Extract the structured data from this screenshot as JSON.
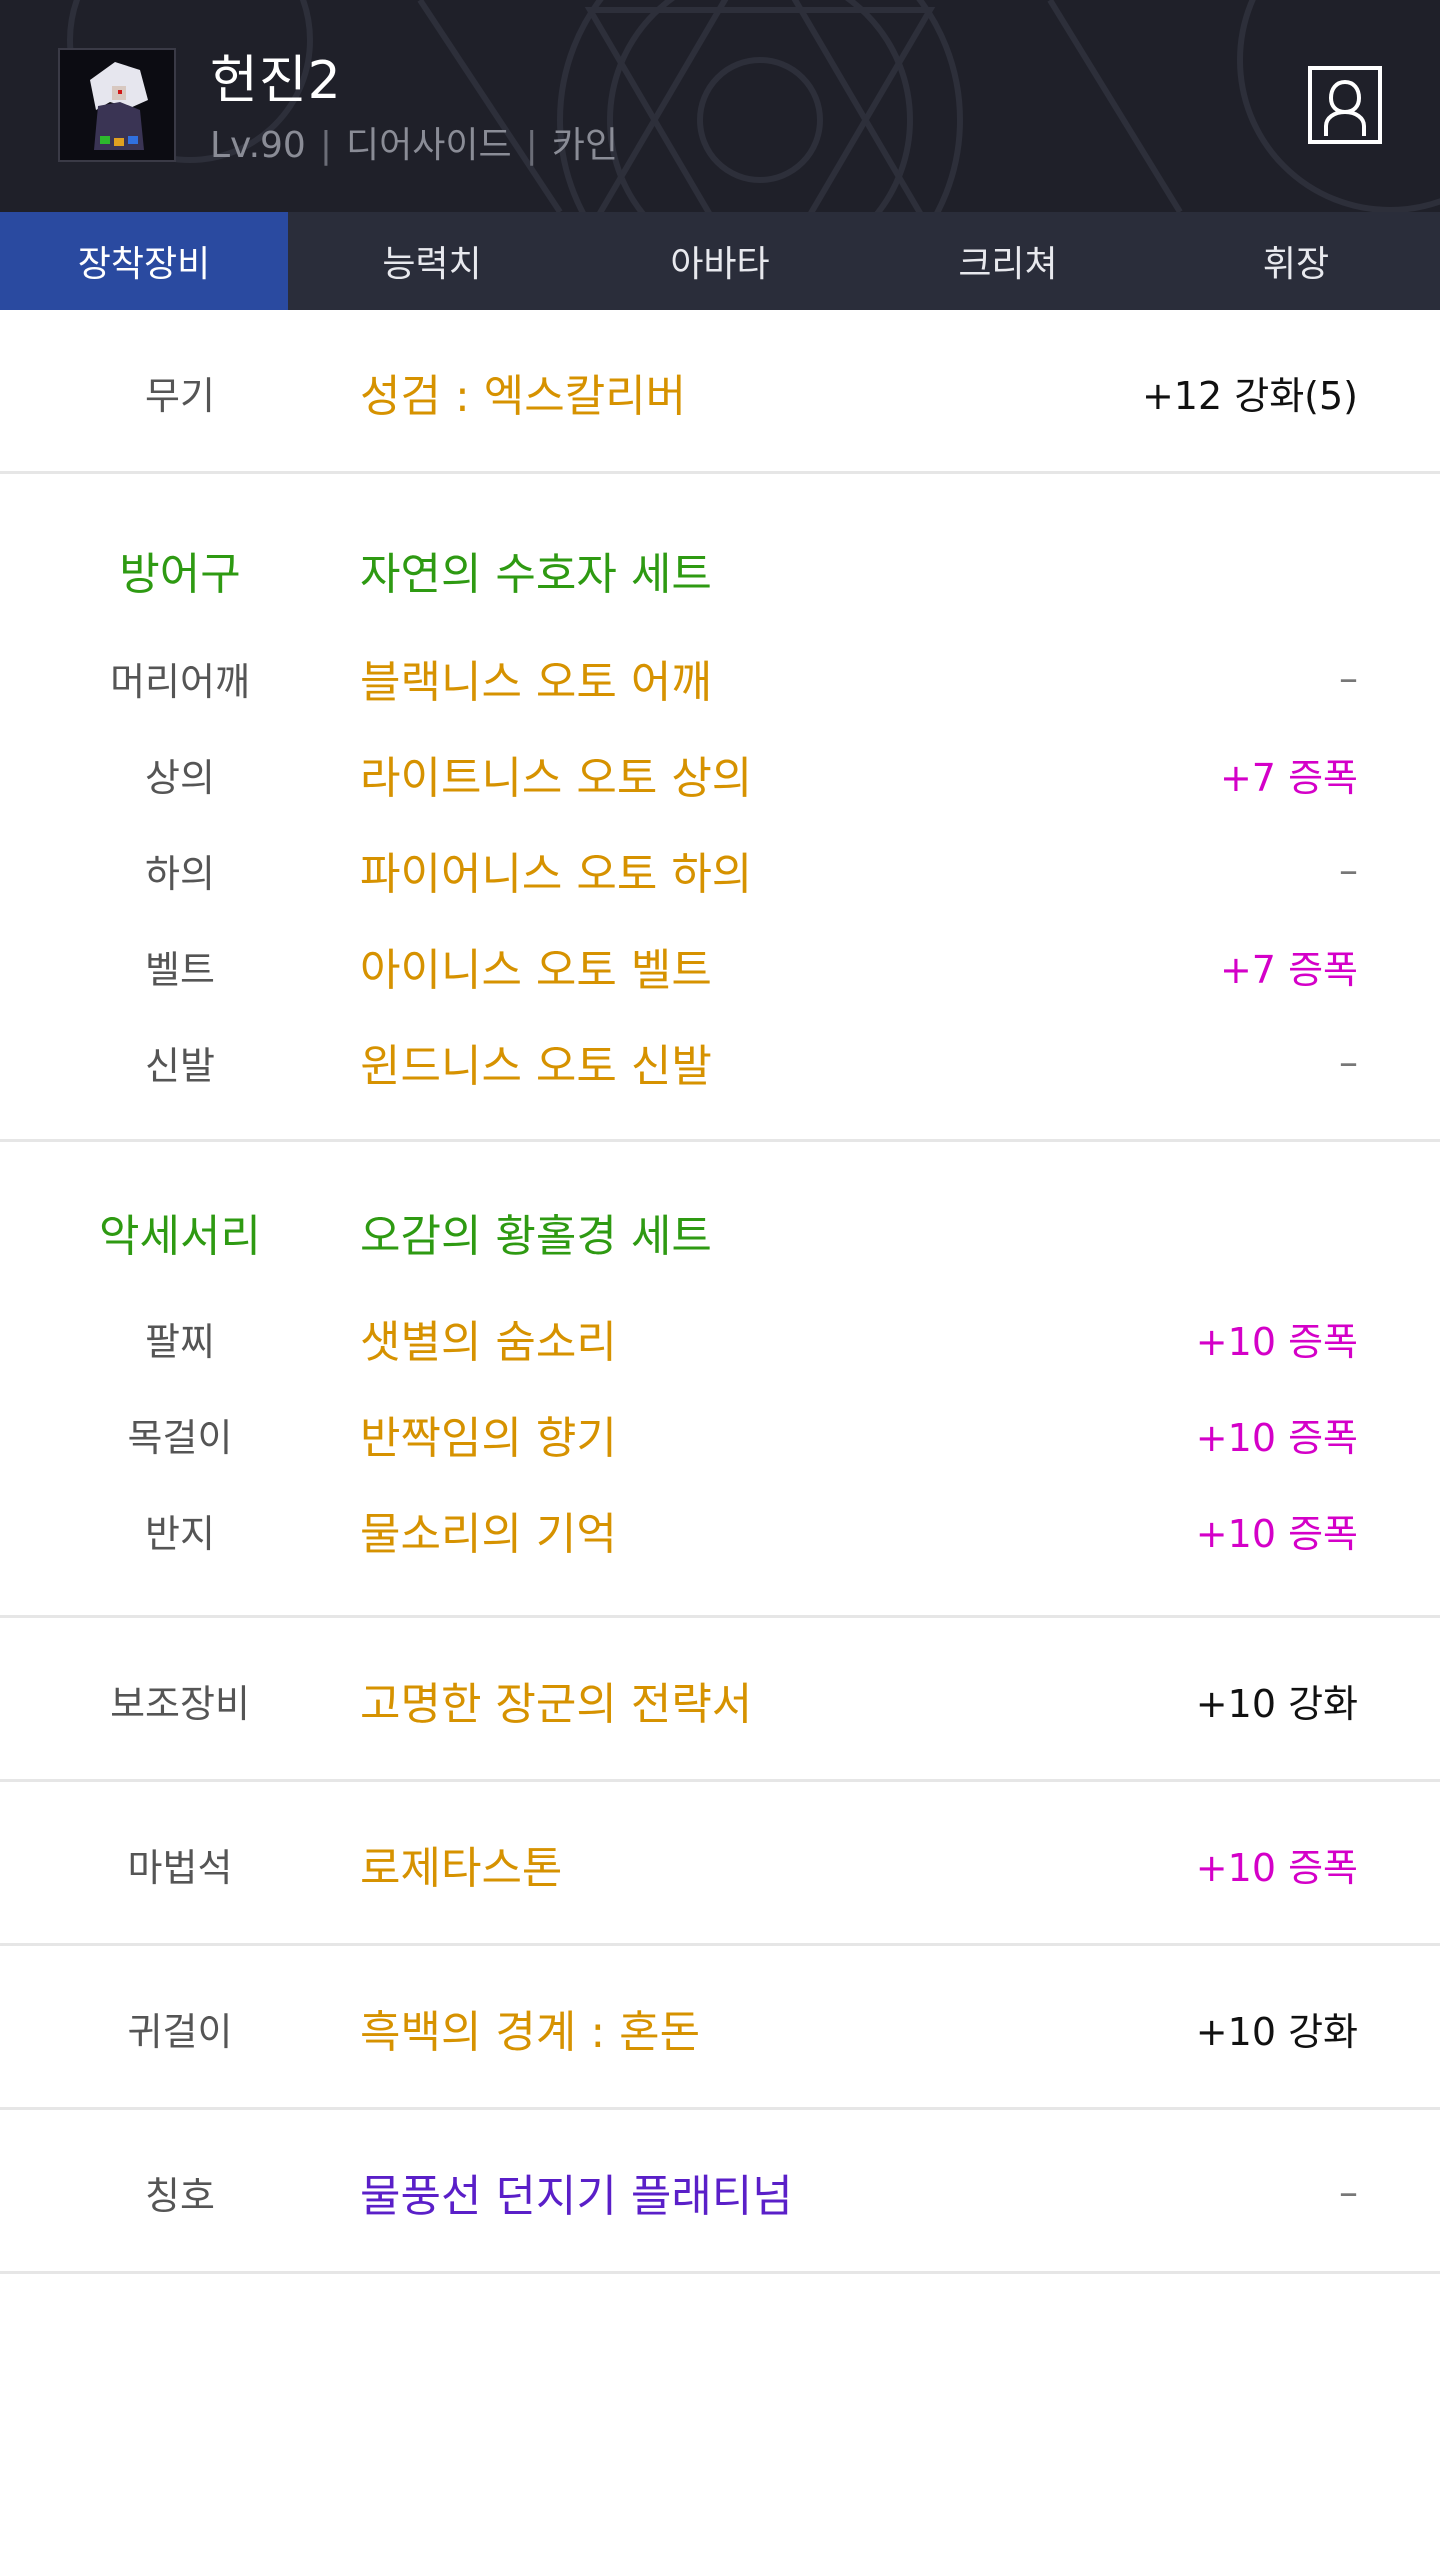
{
  "header": {
    "character_name": "헌진2",
    "level": "Lv.90",
    "job": "디어사이드",
    "server": "카인"
  },
  "tabs": [
    "장착장비",
    "능력치",
    "아바타",
    "크리쳐",
    "휘장"
  ],
  "weapon": {
    "label": "무기",
    "name": "성검 : 엑스칼리버",
    "value": "+12 강화(5)"
  },
  "armor": {
    "label": "방어구",
    "set_name": "자연의 수호자 세트",
    "items": [
      {
        "label": "머리어깨",
        "name": "블랙니스 오토 어깨",
        "value": "–"
      },
      {
        "label": "상의",
        "name": "라이트니스 오토 상의",
        "value": "+7 증폭"
      },
      {
        "label": "하의",
        "name": "파이어니스 오토 하의",
        "value": "–"
      },
      {
        "label": "벨트",
        "name": "아이니스 오토 벨트",
        "value": "+7 증폭"
      },
      {
        "label": "신발",
        "name": "윈드니스 오토 신발",
        "value": "–"
      }
    ]
  },
  "accessory": {
    "label": "악세서리",
    "set_name": "오감의 황홀경 세트",
    "items": [
      {
        "label": "팔찌",
        "name": "샛별의 숨소리",
        "value": "+10 증폭"
      },
      {
        "label": "목걸이",
        "name": "반짝임의 향기",
        "value": "+10 증폭"
      },
      {
        "label": "반지",
        "name": "물소리의 기억",
        "value": "+10 증폭"
      }
    ]
  },
  "sub_equipment": {
    "label": "보조장비",
    "name": "고명한 장군의 전략서",
    "value": "+10 강화"
  },
  "magic_stone": {
    "label": "마법석",
    "name": "로제타스톤",
    "value": "+10 증폭"
  },
  "earring": {
    "label": "귀걸이",
    "name": "흑백의 경계 : 혼돈",
    "value": "+10 강화"
  },
  "title": {
    "label": "칭호",
    "name": "물풍선 던지기 플래티넘",
    "value": "–"
  },
  "colors": {
    "header_bg": "#1f2029",
    "tab_bg": "#2a2d3a",
    "tab_active": "#2a4aa0",
    "item_gold": "#d69200",
    "set_green": "#2e9a12",
    "boost_magenta": "#d400c8",
    "title_purple": "#5a1fc8"
  },
  "icons": {
    "profile": "user-profile-icon",
    "avatar": "character-portrait"
  }
}
